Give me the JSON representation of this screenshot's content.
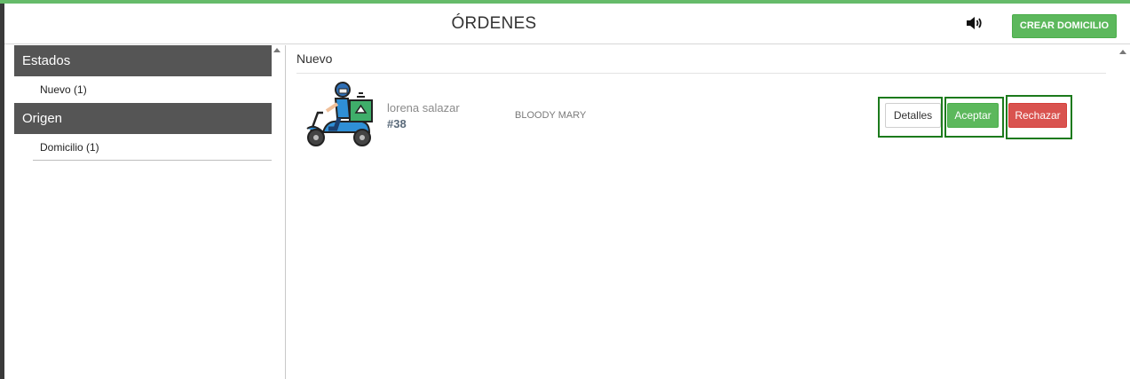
{
  "header": {
    "title": "ÓRDENES",
    "sound_icon": "speaker-volume-icon",
    "create_button": "CREAR DOMICILIO"
  },
  "sidebar": {
    "sections": [
      {
        "title": "Estados",
        "items": [
          {
            "label": "Nuevo (1)"
          }
        ]
      },
      {
        "title": "Origen",
        "items": [
          {
            "label": "Domicilio (1)"
          }
        ]
      }
    ]
  },
  "main": {
    "section_title": "Nuevo",
    "orders": [
      {
        "image_icon": "delivery-scooter-icon",
        "customer": "lorena salazar",
        "number": "#38",
        "item": "BLOODY MARY",
        "actions": {
          "details": "Detalles",
          "accept": "Aceptar",
          "reject": "Rechazar"
        }
      }
    ]
  },
  "colors": {
    "accent_green": "#5cb85c",
    "danger_red": "#d9534f",
    "sidebar_header": "#555555",
    "highlight_border": "#1c7a1c"
  }
}
